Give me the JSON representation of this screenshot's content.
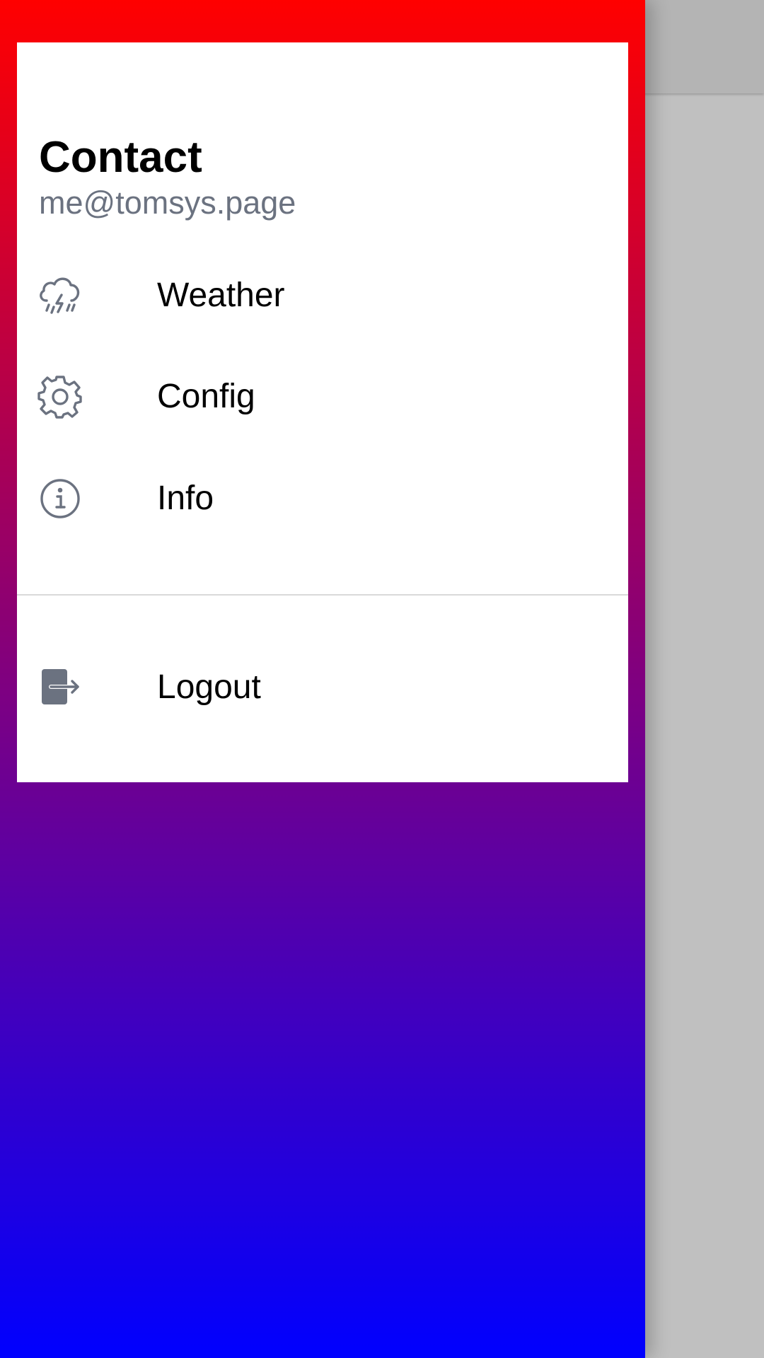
{
  "drawer": {
    "header": {
      "title": "Contact",
      "email": "me@tomsys.page"
    },
    "items": [
      {
        "label": "Weather",
        "icon": "cloud-lightning-rain-icon"
      },
      {
        "label": "Config",
        "icon": "gear-icon"
      },
      {
        "label": "Info",
        "icon": "info-circle-icon"
      }
    ],
    "footer_items": [
      {
        "label": "Logout",
        "icon": "logout-icon"
      }
    ],
    "gradient": {
      "top": "#ff0000",
      "bottom": "#0000ff"
    }
  },
  "colors": {
    "icon": "#6b7280",
    "email": "#6b7280",
    "scrim": "#c0c0c0"
  }
}
